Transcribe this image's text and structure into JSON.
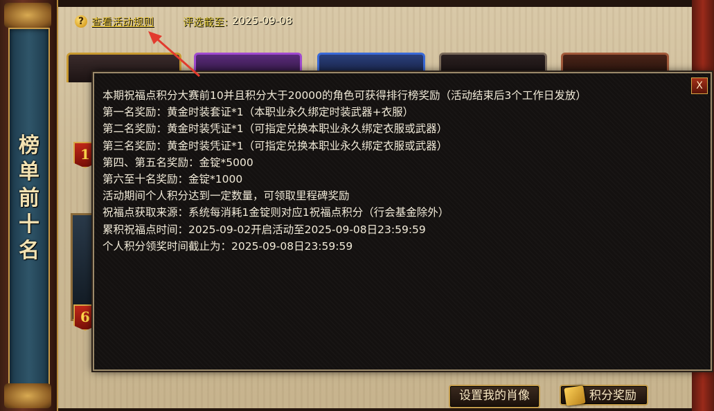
{
  "header": {
    "rules_link": "查看活动规则",
    "deadline_label": "评选截至:",
    "deadline_value": "2025-09-08"
  },
  "left_banner": {
    "title": "榜单前十名"
  },
  "ranks": {
    "first_badge": "1",
    "sixth_badge": "6"
  },
  "popup": {
    "close_glyph": "X",
    "lines": [
      "本期祝福点积分大赛前10并且积分大于20000的角色可获得排行榜奖励（活动结束后3个工作日发放）",
      "第一名奖励：黄金时装套证*1（本职业永久绑定时装武器+衣服）",
      "第二名奖励：黄金时装凭证*1（可指定兑换本职业永久绑定衣服或武器）",
      "第三名奖励：黄金时装凭证*1（可指定兑换本职业永久绑定衣服或武器）",
      "第四、第五名奖励：金锭*5000",
      "第六至十名奖励：金锭*1000",
      "活动期间个人积分达到一定数量，可领取里程碑奖励",
      "祝福点获取来源：系统每消耗1金锭则对应1祝福点积分（行会基金除外）",
      "累积祝福点时间：2025-09-02开启活动至2025-09-08日23:59:59",
      "个人积分领奖时间截止为：2025-09-08日23:59:59"
    ]
  },
  "buttons": {
    "set_portrait": "设置我的肖像",
    "points_reward": "积分奖励"
  },
  "colors": {
    "rules_link": "#e8c53a",
    "popup_bg": "#141110",
    "annotation_arrow": "#e23b2e"
  },
  "icons": {
    "help": "question-icon",
    "close": "close-icon",
    "reward": "book-icon"
  }
}
